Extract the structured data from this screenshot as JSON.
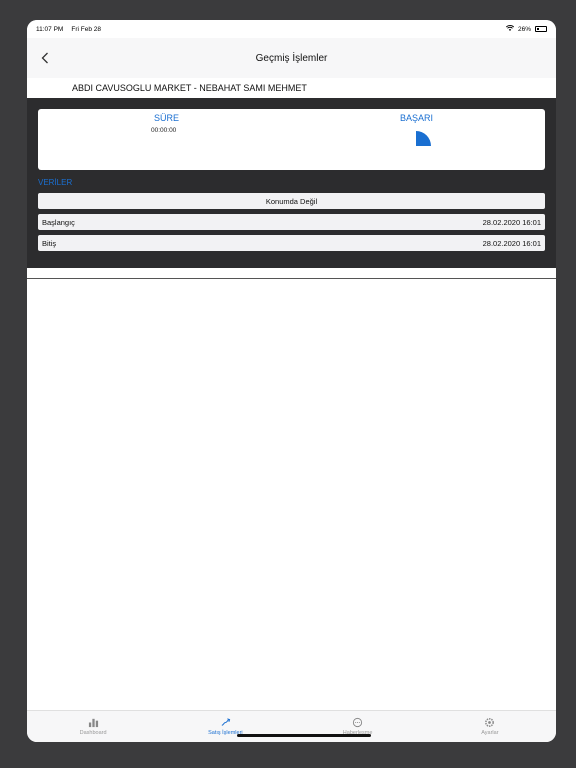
{
  "status": {
    "time": "11:07 PM",
    "date": "Fri Feb 28",
    "battery": "26%"
  },
  "nav": {
    "title": "Geçmiş İşlemler"
  },
  "subheader": {
    "text": "ABDI CAVUSOGLU MARKET - NEBAHAT SAMI MEHMET"
  },
  "summary": {
    "sure_label": "SÜRE",
    "sure_value": "00:00:00",
    "basari_label": "BAŞARI",
    "basari_fraction": 0.25
  },
  "veriler": {
    "title": "VERİLER",
    "location_status": "Konumda Değil",
    "rows": [
      {
        "label": "Başlangıç",
        "value": "28.02.2020 16:01"
      },
      {
        "label": "Bitiş",
        "value": "28.02.2020 16:01"
      }
    ]
  },
  "tabs": [
    {
      "label": "Dashboard",
      "icon": "bar-chart-icon",
      "active": false
    },
    {
      "label": "Satış İşlemleri",
      "icon": "sales-icon",
      "active": true
    },
    {
      "label": "Haberleşme",
      "icon": "chat-icon",
      "active": false
    },
    {
      "label": "Ayarlar",
      "icon": "gear-icon",
      "active": false
    }
  ],
  "colors": {
    "accent": "#1a6fd1",
    "panel": "#2c2c2e"
  }
}
